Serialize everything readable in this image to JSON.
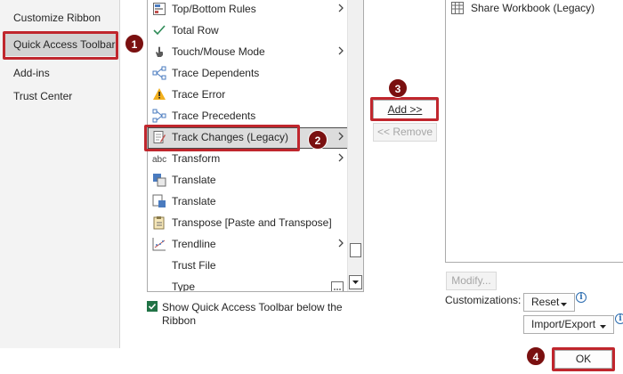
{
  "nav": {
    "items": [
      {
        "label": "Customize Ribbon"
      },
      {
        "label": "Quick Access Toolbar"
      },
      {
        "label": "Add-ins"
      },
      {
        "label": "Trust Center"
      }
    ]
  },
  "commands": [
    {
      "label": "Top/Bottom Rules",
      "icon": "top-bottom-rules-icon",
      "submenu": true
    },
    {
      "label": "Total Row",
      "icon": "checkmark-icon",
      "submenu": false
    },
    {
      "label": "Touch/Mouse Mode",
      "icon": "hand-icon",
      "submenu": true
    },
    {
      "label": "Trace Dependents",
      "icon": "trace-dependents-icon",
      "submenu": false
    },
    {
      "label": "Trace Error",
      "icon": "warning-icon",
      "submenu": false
    },
    {
      "label": "Trace Precedents",
      "icon": "trace-precedents-icon",
      "submenu": false
    },
    {
      "label": "Track Changes (Legacy)",
      "icon": "track-changes-icon",
      "submenu": true
    },
    {
      "label": "Transform",
      "icon": "transform-abc-icon",
      "submenu": true
    },
    {
      "label": "Translate",
      "icon": "translate-icon",
      "submenu": false
    },
    {
      "label": "Translate",
      "icon": "translate-icon",
      "submenu": false
    },
    {
      "label": "Transpose [Paste and Transpose]",
      "icon": "transpose-icon",
      "submenu": false
    },
    {
      "label": "Trendline",
      "icon": "trendline-icon",
      "submenu": true
    },
    {
      "label": "Trust File",
      "icon": "",
      "submenu": false
    },
    {
      "label": "Type",
      "icon": "",
      "submenu": false
    }
  ],
  "buttons": {
    "add": "Add >>",
    "remove": "<< Remove",
    "modify": "Modify...",
    "reset": "Reset",
    "import_export": "Import/Export",
    "ok": "OK"
  },
  "right_list": {
    "items": [
      {
        "label": "Share Workbook (Legacy)"
      }
    ]
  },
  "checkbox": {
    "label": "Show Quick Access Toolbar below the Ribbon",
    "checked": true
  },
  "customizations_label": "Customizations:",
  "badges": [
    "1",
    "2",
    "3",
    "4"
  ],
  "colors": {
    "callout": "#c0262d",
    "badge": "#7a1010",
    "checkbox": "#217346"
  }
}
